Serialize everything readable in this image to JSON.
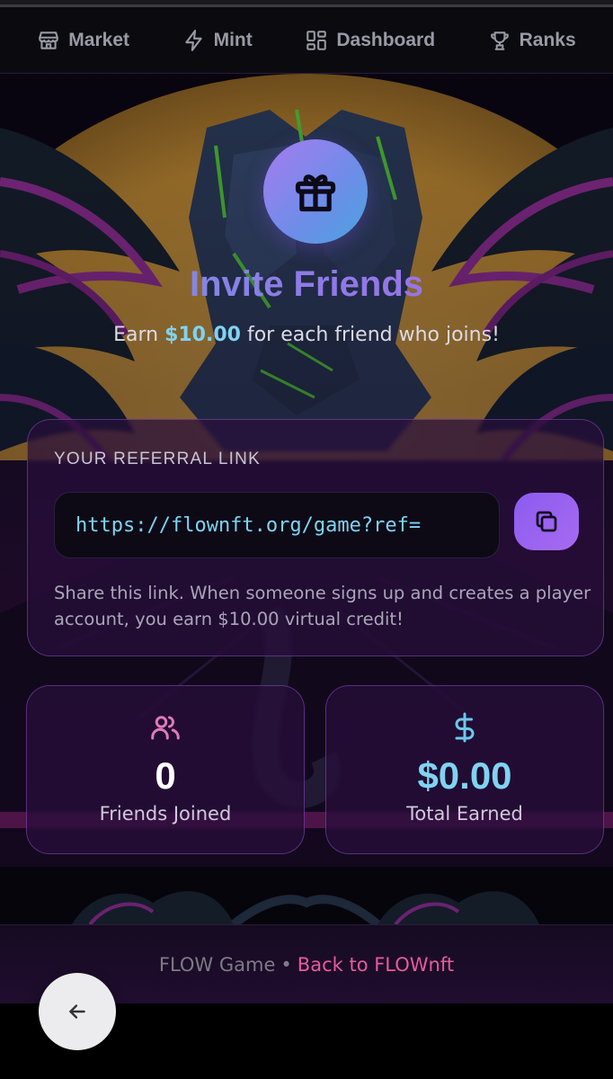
{
  "nav": {
    "items": [
      {
        "label": "Market",
        "icon": "store-icon"
      },
      {
        "label": "Mint",
        "icon": "lightning-icon"
      },
      {
        "label": "Dashboard",
        "icon": "grid-icon"
      },
      {
        "label": "Ranks",
        "icon": "trophy-icon"
      }
    ]
  },
  "hero": {
    "icon": "gift-icon",
    "title": "Invite Friends",
    "subtitle_prefix": "Earn ",
    "subtitle_amount": "$10.00",
    "subtitle_suffix": " for each friend who joins!"
  },
  "referral": {
    "label": "YOUR REFERRAL LINK",
    "link": "https://flownft.org/game?ref=",
    "copy_icon": "copy-icon",
    "help_text": "Share this link. When someone signs up and creates a player account, you earn $10.00 virtual credit!"
  },
  "stats": [
    {
      "icon": "users-icon",
      "value": "0",
      "label": "Friends Joined",
      "color": "#ffffff",
      "icon_color": "#e07ab8"
    },
    {
      "icon": "dollar-icon",
      "value": "$0.00",
      "label": "Total Earned",
      "color": "#7fd3f0",
      "icon_color": "#6cc8ec"
    }
  ],
  "footer": {
    "brand": "FLOW Game",
    "separator": "•",
    "link": "Back to FLOWnft"
  },
  "fab": {
    "icon": "arrow-left-icon"
  },
  "colors": {
    "accent_purple": "#8b5cf0",
    "accent_cyan": "#7fd3f0",
    "accent_pink": "#e85a9c"
  }
}
